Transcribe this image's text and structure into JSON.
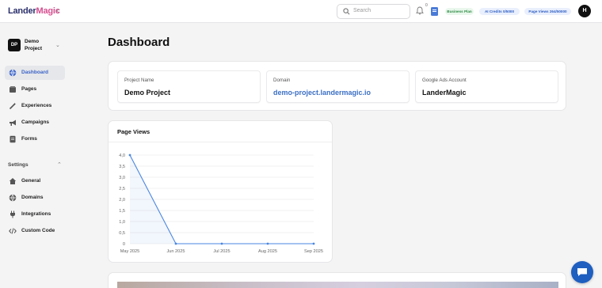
{
  "header": {
    "logo_part1": "Lander",
    "logo_part2": "Magic",
    "search_placeholder": "Search",
    "notification_count": "0",
    "plan_badge": "Business Plan",
    "ai_credits": "AI Credits 0/5000",
    "page_views": "Page Views 264/50000",
    "avatar_initial": "H"
  },
  "sidebar": {
    "project_initials": "DP",
    "project_name": "Demo Project",
    "items": [
      {
        "label": "Dashboard",
        "icon": "globe-icon"
      },
      {
        "label": "Pages",
        "icon": "pages-icon"
      },
      {
        "label": "Experiences",
        "icon": "wand-icon"
      },
      {
        "label": "Campaigns",
        "icon": "megaphone-icon"
      },
      {
        "label": "Forms",
        "icon": "form-icon"
      }
    ],
    "settings_label": "Settings",
    "settings_items": [
      {
        "label": "General",
        "icon": "home-icon"
      },
      {
        "label": "Domains",
        "icon": "globe-icon"
      },
      {
        "label": "Integrations",
        "icon": "plug-icon"
      },
      {
        "label": "Custom Code",
        "icon": "code-icon"
      }
    ]
  },
  "main": {
    "title": "Dashboard",
    "cards": [
      {
        "label": "Project Name",
        "value": "Demo Project"
      },
      {
        "label": "Domain",
        "value": "demo-project.landermagic.io"
      },
      {
        "label": "Google Ads Account",
        "value": "LanderMagic"
      }
    ],
    "chart_title": "Page Views"
  },
  "colors": {
    "accent": "#3b6fc4",
    "line": "#4a86e0",
    "chat": "#1e5fc0"
  },
  "chart_data": {
    "type": "line",
    "title": "Page Views",
    "categories": [
      "May 2025",
      "Jun 2025",
      "Jul 2025",
      "Aug 2025",
      "Sep 2025"
    ],
    "values": [
      4.0,
      0,
      0,
      0,
      0
    ],
    "ylim": [
      0,
      4.0
    ],
    "yticks": [
      "0",
      "0,5",
      "1,0",
      "1,5",
      "2,0",
      "2,5",
      "3,0",
      "3,5",
      "4,0"
    ],
    "grid": true
  }
}
